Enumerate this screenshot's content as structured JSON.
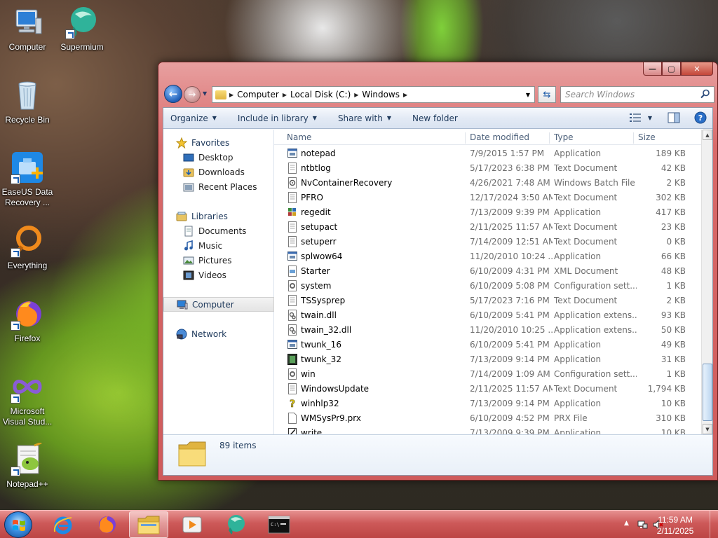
{
  "desktop": {
    "icons": [
      {
        "label": "Computer"
      },
      {
        "label": "Supermium"
      },
      {
        "label": "Recycle Bin"
      },
      {
        "label": "EaseUS Data Recovery ..."
      },
      {
        "label": "Everything"
      },
      {
        "label": "Firefox"
      },
      {
        "label": "Microsoft Visual Stud..."
      },
      {
        "label": "Notepad++"
      }
    ]
  },
  "window": {
    "controls": {
      "minimize": "—",
      "maximize": "▢",
      "close": "✕"
    },
    "address": {
      "crumbs": [
        "Computer",
        "Local Disk (C:)",
        "Windows"
      ]
    },
    "search": {
      "placeholder": "Search Windows"
    },
    "toolbar": {
      "organize": "Organize",
      "include": "Include in library",
      "share": "Share with",
      "new_folder": "New folder"
    },
    "nav": {
      "favorites": "Favorites",
      "desktop": "Desktop",
      "downloads": "Downloads",
      "recent": "Recent Places",
      "libraries": "Libraries",
      "documents": "Documents",
      "music": "Music",
      "pictures": "Pictures",
      "videos": "Videos",
      "computer": "Computer",
      "network": "Network"
    },
    "columns": {
      "name": "Name",
      "date": "Date modified",
      "type": "Type",
      "size": "Size"
    },
    "files": [
      {
        "name": "notepad",
        "date": "7/9/2015 1:57 PM",
        "type": "Application",
        "size": "189 KB",
        "icon": "app-icon"
      },
      {
        "name": "ntbtlog",
        "date": "5/17/2023 6:38 PM",
        "type": "Text Document",
        "size": "42 KB",
        "icon": "text-file-icon"
      },
      {
        "name": "NvContainerRecovery",
        "date": "4/26/2021 7:48 AM",
        "type": "Windows Batch File",
        "size": "2 KB",
        "icon": "batch-file-icon"
      },
      {
        "name": "PFRO",
        "date": "12/17/2024 3:50 AM",
        "type": "Text Document",
        "size": "302 KB",
        "icon": "text-file-icon"
      },
      {
        "name": "regedit",
        "date": "7/13/2009 9:39 PM",
        "type": "Application",
        "size": "417 KB",
        "icon": "regedit-icon"
      },
      {
        "name": "setupact",
        "date": "2/11/2025 11:57 AM",
        "type": "Text Document",
        "size": "23 KB",
        "icon": "text-file-icon"
      },
      {
        "name": "setuperr",
        "date": "7/14/2009 12:51 AM",
        "type": "Text Document",
        "size": "0 KB",
        "icon": "text-file-icon"
      },
      {
        "name": "splwow64",
        "date": "11/20/2010 10:24 ...",
        "type": "Application",
        "size": "66 KB",
        "icon": "app-icon"
      },
      {
        "name": "Starter",
        "date": "6/10/2009 4:31 PM",
        "type": "XML Document",
        "size": "48 KB",
        "icon": "xml-file-icon"
      },
      {
        "name": "system",
        "date": "6/10/2009 5:08 PM",
        "type": "Configuration sett...",
        "size": "1 KB",
        "icon": "config-file-icon"
      },
      {
        "name": "TSSysprep",
        "date": "5/17/2023 7:16 PM",
        "type": "Text Document",
        "size": "2 KB",
        "icon": "text-file-icon"
      },
      {
        "name": "twain.dll",
        "date": "6/10/2009 5:41 PM",
        "type": "Application extens...",
        "size": "93 KB",
        "icon": "dll-file-icon"
      },
      {
        "name": "twain_32.dll",
        "date": "11/20/2010 10:25 ...",
        "type": "Application extens...",
        "size": "50 KB",
        "icon": "dll-file-icon"
      },
      {
        "name": "twunk_16",
        "date": "6/10/2009 5:41 PM",
        "type": "Application",
        "size": "49 KB",
        "icon": "app-icon"
      },
      {
        "name": "twunk_32",
        "date": "7/13/2009 9:14 PM",
        "type": "Application",
        "size": "31 KB",
        "icon": "twunk-app-icon"
      },
      {
        "name": "win",
        "date": "7/14/2009 1:09 AM",
        "type": "Configuration sett...",
        "size": "1 KB",
        "icon": "config-file-icon"
      },
      {
        "name": "WindowsUpdate",
        "date": "2/11/2025 11:57 AM",
        "type": "Text Document",
        "size": "1,794 KB",
        "icon": "text-file-icon"
      },
      {
        "name": "winhlp32",
        "date": "7/13/2009 9:14 PM",
        "type": "Application",
        "size": "10 KB",
        "icon": "help-icon"
      },
      {
        "name": "WMSysPr9.prx",
        "date": "6/10/2009 4:52 PM",
        "type": "PRX File",
        "size": "310 KB",
        "icon": "blank-file-icon"
      },
      {
        "name": "write",
        "date": "7/13/2009 9:39 PM",
        "type": "Application",
        "size": "10 KB",
        "icon": "write-app-icon"
      }
    ],
    "details": {
      "count": "89 items"
    }
  },
  "taskbar": {
    "clock_time": "11:59 AM",
    "clock_date": "2/11/2025"
  },
  "colors": {
    "window_frame": "#d86a6a",
    "taskbar": "#d65c5c",
    "link_blue": "#1e395b"
  }
}
